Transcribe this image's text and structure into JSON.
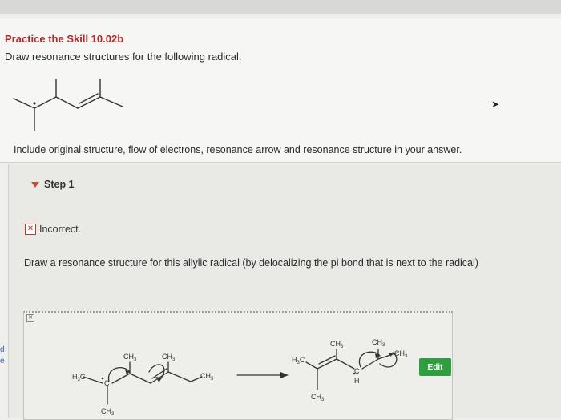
{
  "problem": {
    "title": "Practice the Skill 10.02b",
    "prompt": "Draw resonance structures for the following radical:",
    "include_text": "Include original structure, flow of electrons, resonance arrow and resonance structure in your answer."
  },
  "step": {
    "label": "Step 1",
    "status": "Incorrect.",
    "instruction": "Draw a resonance structure for this allylic radical (by delocalizing the pi bond that is next to the radical)"
  },
  "answer": {
    "edit_label": "Edit",
    "labels": {
      "ch3": "CH",
      "sub3": "3",
      "h3c_h": "H",
      "h3c_c": "C",
      "c_dot": "C",
      "c_dot2": "C",
      "h": "H"
    }
  },
  "edge": {
    "line1": "d",
    "line2": "e"
  },
  "colors": {
    "title_red": "#b02a2a",
    "edit_green": "#2e9e3e",
    "incorrect_red": "#c0392b",
    "step_triangle": "#d04a3a"
  }
}
